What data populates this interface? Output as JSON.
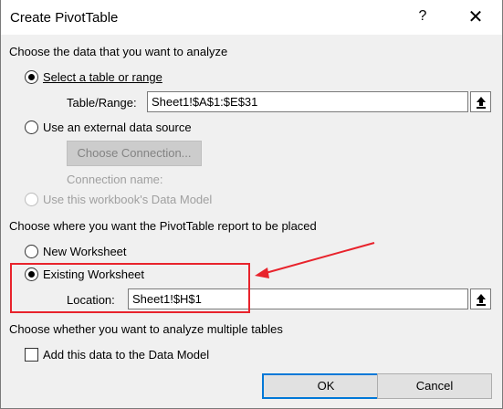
{
  "window": {
    "title": "Create PivotTable",
    "help_glyph": "?",
    "close_glyph": "✕"
  },
  "section_data": {
    "heading": "Choose the data that you want to analyze",
    "option_table": "Select a table or range",
    "table_range_label": "Table/Range:",
    "table_range_value": "Sheet1!$A$1:$E$31",
    "option_external": "Use an external data source",
    "choose_connection_button": "Choose Connection...",
    "connection_name_label": "Connection name:",
    "option_data_model": "Use this workbook's Data Model"
  },
  "section_placement": {
    "heading": "Choose where you want the PivotTable report to be placed",
    "option_new": "New Worksheet",
    "option_existing": "Existing Worksheet",
    "location_label": "Location:",
    "location_value": "Sheet1!$H$1"
  },
  "section_multiple": {
    "heading": "Choose whether you want to analyze multiple tables",
    "add_to_data_model": "Add this data to the Data Model"
  },
  "buttons": {
    "ok": "OK",
    "cancel": "Cancel"
  },
  "annotation": {
    "color": "#e8232c"
  }
}
